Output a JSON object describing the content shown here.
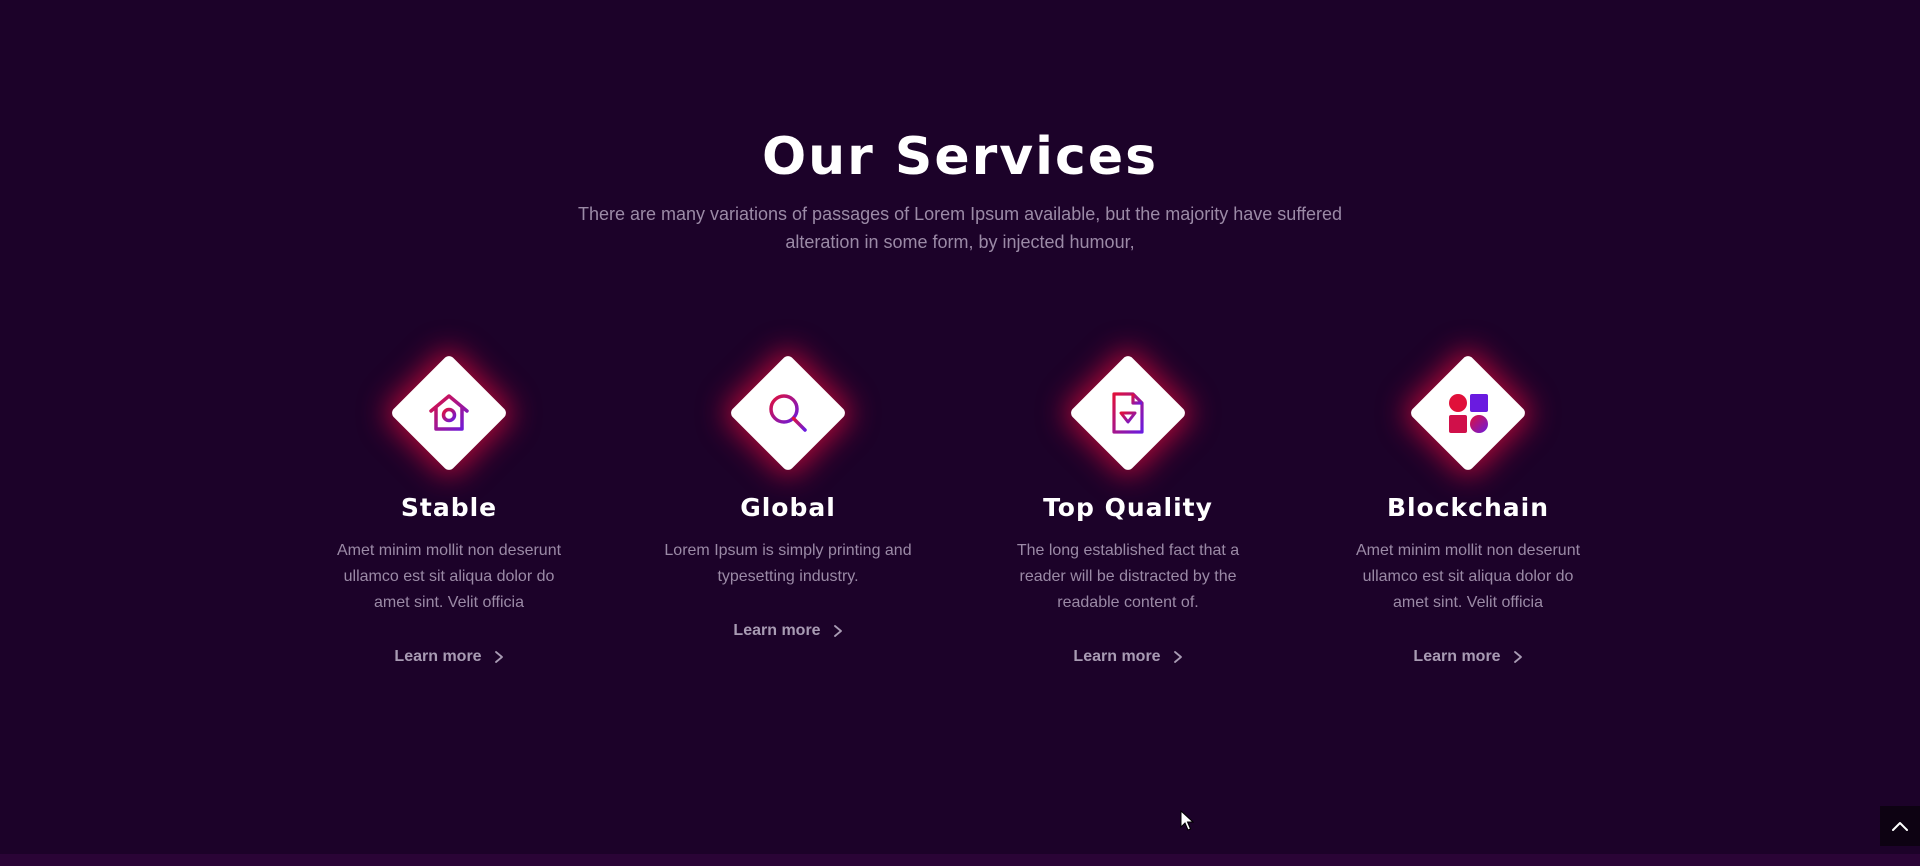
{
  "section": {
    "title": "Our Services",
    "subtitle": "There are many variations of passages of Lorem Ipsum available, but the majority have suffered alteration in some form, by injected humour,"
  },
  "services": [
    {
      "icon": "house-icon",
      "title": "Stable",
      "text": "Amet minim mollit non deserunt ullamco est sit aliqua dolor do amet sint. Velit officia",
      "link": "Learn more"
    },
    {
      "icon": "magnifier-icon",
      "title": "Global",
      "text": "Lorem Ipsum is simply printing and typesetting industry.",
      "link": "Learn more"
    },
    {
      "icon": "document-diamond-icon",
      "title": "Top Quality",
      "text": "The long established fact that a reader will be distracted by the readable content of.",
      "link": "Learn more"
    },
    {
      "icon": "shapes-grid-icon",
      "title": "Blockchain",
      "text": "Amet minim mollit non deserunt ullamco est sit aliqua dolor do amet sint. Velit officia",
      "link": "Learn more"
    }
  ],
  "colors": {
    "background": "#1c0229",
    "accent_start": "#e0103a",
    "accent_end": "#6a1be0",
    "muted_text": "#9b8aa6"
  },
  "scroll_top": {
    "icon": "chevron-up-icon"
  }
}
